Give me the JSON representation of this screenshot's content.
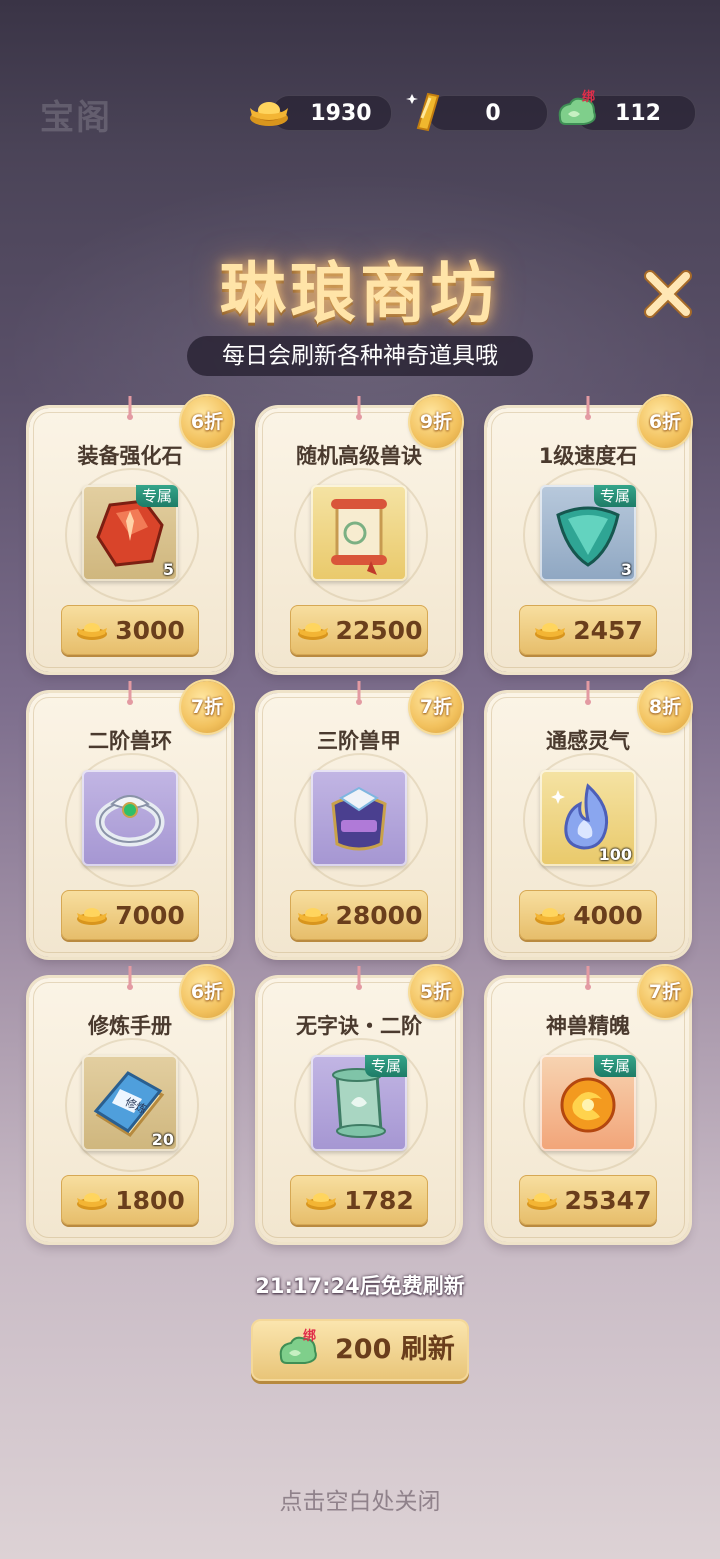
{
  "header": {
    "home_label": "宝阁",
    "currencies": [
      {
        "icon": "gold-ingot-icon",
        "value": "1930"
      },
      {
        "icon": "gold-bar-icon",
        "value": "0"
      },
      {
        "icon": "bound-jade-icon",
        "value": "112",
        "bound_label": "绑"
      }
    ]
  },
  "shop": {
    "title": "琳琅商坊",
    "subtitle": "每日会刷新各种神奇道具哦",
    "items": [
      {
        "name": "装备强化石",
        "discount": "6折",
        "price": "3000",
        "count": "5",
        "tag": "专属",
        "icon": "red-stone-icon",
        "quality": "wood"
      },
      {
        "name": "随机高级兽诀",
        "discount": "9折",
        "price": "22500",
        "count": "",
        "tag": "",
        "icon": "scroll-icon",
        "quality": "gold"
      },
      {
        "name": "1级速度石",
        "discount": "6折",
        "price": "2457",
        "count": "3",
        "tag": "专属",
        "icon": "teal-gem-icon",
        "quality": "blue"
      },
      {
        "name": "二阶兽环",
        "discount": "7折",
        "price": "7000",
        "count": "",
        "tag": "",
        "icon": "silver-ring-icon",
        "quality": "purple"
      },
      {
        "name": "三阶兽甲",
        "discount": "7折",
        "price": "28000",
        "count": "",
        "tag": "",
        "icon": "armor-icon",
        "quality": "purple"
      },
      {
        "name": "通感灵气",
        "discount": "8折",
        "price": "4000",
        "count": "100",
        "tag": "",
        "icon": "spirit-flame-icon",
        "quality": "gold"
      },
      {
        "name": "修炼手册",
        "discount": "6折",
        "price": "1800",
        "count": "20",
        "tag": "",
        "icon": "book-icon",
        "book_text": "修炼",
        "quality": "wood"
      },
      {
        "name": "无字诀・二阶",
        "discount": "5折",
        "price": "1782",
        "count": "",
        "tag": "专属",
        "icon": "green-scroll-icon",
        "quality": "purple"
      },
      {
        "name": "神兽精魄",
        "discount": "7折",
        "price": "25347",
        "count": "",
        "tag": "专属",
        "icon": "fire-orb-icon",
        "quality": "orange"
      }
    ]
  },
  "footer": {
    "timer_text": "21:17:24后免费刷新",
    "refresh_button": {
      "bound_label": "绑",
      "label": "200 刷新"
    },
    "close_hint": "点击空白处关闭"
  },
  "colors": {
    "accent_gold": "#e6bd6a",
    "title_glow": "#ffe4a8",
    "tag_green": "#1e7c67"
  }
}
